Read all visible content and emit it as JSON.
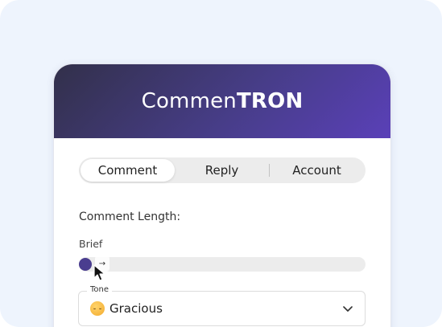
{
  "app": {
    "brand_regular": "Commen",
    "brand_bold": "TRON"
  },
  "tabs": [
    {
      "label": "Comment",
      "active": true
    },
    {
      "label": "Reply",
      "active": false
    },
    {
      "label": "Account",
      "active": false
    }
  ],
  "comment_length": {
    "label": "Comment Length:",
    "selected_value": "Brief",
    "slider_position": 0,
    "hint_glyph": "→"
  },
  "tone": {
    "legend": "Tone",
    "selected_value": "Gracious",
    "emoji_icon": "hugging-face-emoji"
  },
  "colors": {
    "header_start": "#32304a",
    "header_end": "#5a40b8",
    "slider_thumb": "#4a3d8f",
    "page_background": "#eef4fd"
  }
}
